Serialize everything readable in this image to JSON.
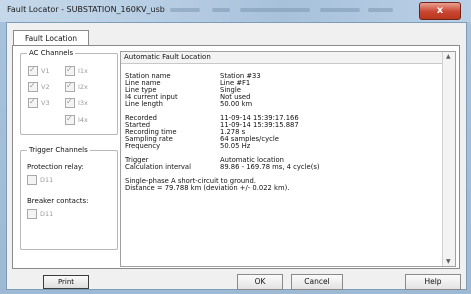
{
  "window": {
    "title": "Fault Locator - SUBSTATION_160KV_usb",
    "close_label": "x"
  },
  "tabs": [
    {
      "label": "Fault Location"
    }
  ],
  "ac_channels": {
    "title": "AC Channels",
    "items": [
      {
        "label": "V1",
        "checked": true
      },
      {
        "label": "I1x",
        "checked": true
      },
      {
        "label": "V2",
        "checked": true
      },
      {
        "label": "I2x",
        "checked": true
      },
      {
        "label": "V3",
        "checked": true
      },
      {
        "label": "I3x",
        "checked": true
      },
      {
        "label": "I4x",
        "checked": true
      }
    ]
  },
  "trigger_channels": {
    "title": "Trigger Channels",
    "protection_relay_label": "Protection relay:",
    "protection_relay_item": "D11",
    "breaker_contacts_label": "Breaker contacts:",
    "breaker_contacts_item": "D11"
  },
  "buttons": {
    "print": "Print",
    "ok": "OK",
    "cancel": "Cancel",
    "help": "Help"
  },
  "report": {
    "heading": "Automatic Fault Location",
    "group1": [
      {
        "key": "Station name",
        "value": "Station #33"
      },
      {
        "key": "Line name",
        "value": "Line #F1"
      },
      {
        "key": "Line type",
        "value": "Single"
      },
      {
        "key": "I4 current input",
        "value": "Not used"
      },
      {
        "key": "Line length",
        "value": "50.00 km"
      }
    ],
    "group2": [
      {
        "key": "Recorded",
        "value": "11-09-14  15:39:17.166"
      },
      {
        "key": "Started",
        "value": "11-09-14  15:39:15.887"
      },
      {
        "key": "Recording time",
        "value": "1.278 s"
      },
      {
        "key": "Sampling rate",
        "value": "64 samples/cycle"
      },
      {
        "key": "Frequency",
        "value": "50.05 Hz"
      }
    ],
    "group3": [
      {
        "key": "Trigger",
        "value": "Automatic location"
      },
      {
        "key": "Calculation interval",
        "value": "89.86 - 169.78  ms, 4 cycle(s)"
      }
    ],
    "summary_line1": "Single-phase A short-circuit to ground.",
    "summary_line2": "Distance = 79.788 km (deviation +/- 0.022 km)."
  }
}
